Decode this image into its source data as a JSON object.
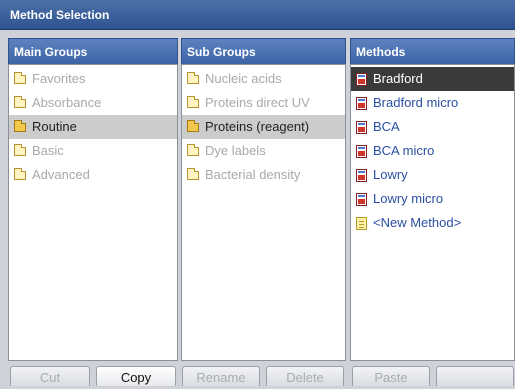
{
  "window": {
    "title": "Method Selection"
  },
  "main_groups": {
    "header": "Main Groups",
    "items": [
      {
        "label": "Favorites",
        "selected": false
      },
      {
        "label": "Absorbance",
        "selected": false
      },
      {
        "label": "Routine",
        "selected": true
      },
      {
        "label": "Basic",
        "selected": false
      },
      {
        "label": "Advanced",
        "selected": false
      }
    ]
  },
  "sub_groups": {
    "header": "Sub Groups",
    "items": [
      {
        "label": "Nucleic acids",
        "selected": false
      },
      {
        "label": "Proteins direct UV",
        "selected": false
      },
      {
        "label": "Proteins (reagent)",
        "selected": true
      },
      {
        "label": "Dye labels",
        "selected": false
      },
      {
        "label": "Bacterial density",
        "selected": false
      }
    ]
  },
  "methods": {
    "header": "Methods",
    "items": [
      {
        "label": "Bradford",
        "selected": true,
        "icon": "method-doc-icon"
      },
      {
        "label": "Bradford micro",
        "selected": false,
        "icon": "method-doc-icon"
      },
      {
        "label": "BCA",
        "selected": false,
        "icon": "method-doc-icon"
      },
      {
        "label": "BCA micro",
        "selected": false,
        "icon": "method-doc-icon"
      },
      {
        "label": "Lowry",
        "selected": false,
        "icon": "method-doc-icon"
      },
      {
        "label": "Lowry micro",
        "selected": false,
        "icon": "method-doc-icon"
      },
      {
        "label": "<New Method>",
        "selected": false,
        "icon": "new-doc-icon"
      }
    ]
  },
  "toolbar": {
    "cut": "Cut",
    "copy": "Copy",
    "rename": "Rename",
    "delete": "Delete",
    "paste": "Paste"
  },
  "colors": {
    "title_bar": "#2f5491",
    "header": "#3c64a6",
    "method_text": "#2b4fa3",
    "selected_method": "#3a3a3a"
  }
}
